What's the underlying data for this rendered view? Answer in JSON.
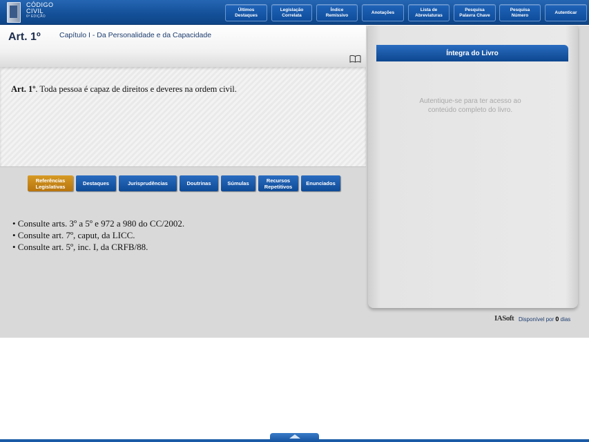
{
  "app": {
    "logo_line1": "CÓDIGO",
    "logo_line2": "CIVIL",
    "logo_line3": "6ª EDIÇÃO"
  },
  "topnav": [
    {
      "label": "Últimos\nDestaques"
    },
    {
      "label": "Legislação\nCorrelata"
    },
    {
      "label": "Índice\nRemissivo"
    },
    {
      "label": "Anotações"
    },
    {
      "label": "Lista de\nAbreviaturas"
    },
    {
      "label": "Pesquisa\nPalavra Chave"
    },
    {
      "label": "Pesquisa\nNúmero"
    },
    {
      "label": "Autenticar"
    }
  ],
  "article": {
    "title": "Art. 1º",
    "chapter": "Capítulo I - Da Personalidade e da Capacidade",
    "text_bold": "Art. 1º",
    "text_rest": ". Toda pessoa é capaz de direitos e deveres na ordem civil."
  },
  "tabs": [
    {
      "label": "Referências\nLegislativas",
      "active": true
    },
    {
      "label": "Destaques"
    },
    {
      "label": "Jurisprudências"
    },
    {
      "label": "Doutrinas"
    },
    {
      "label": "Súmulas"
    },
    {
      "label": "Recursos\nRepetitivos"
    },
    {
      "label": "Enunciados"
    }
  ],
  "references": [
    "• Consulte arts. 3º a 5º e 972 a 980 do CC/2002.",
    "• Consulte art. 7º, caput, da LICC.",
    "• Consulte art. 5º, inc. I, da CRFB/88."
  ],
  "side_panel": {
    "header": "Íntegra do Livro",
    "message_line1": "Autentique-se para ter acesso ao",
    "message_line2": "conteúdo completo do livro."
  },
  "footer": {
    "brand": "IASoft",
    "available_prefix": "Disponível por",
    "days_count": "0",
    "days_suffix": "dias"
  },
  "colors": {
    "primary_blue": "#134f97",
    "active_tab": "#c9861a",
    "panel_gray": "#d9d9d9"
  }
}
